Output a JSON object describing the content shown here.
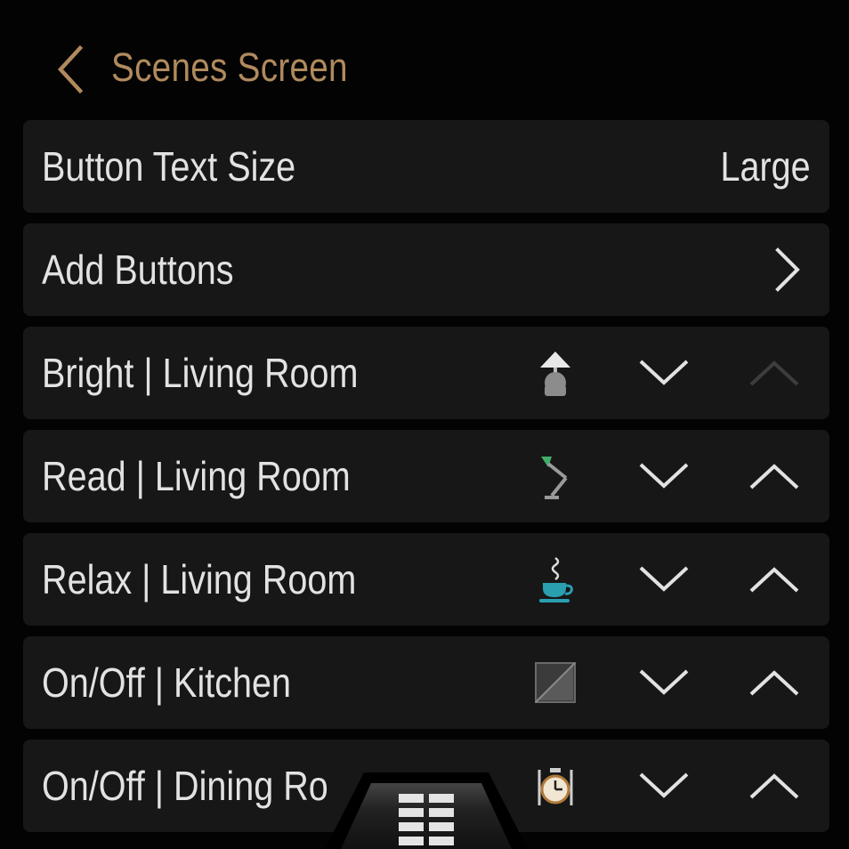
{
  "header": {
    "title": "Scenes Screen",
    "back_icon": "chevron-left-icon",
    "accent_color": "#b08a5e"
  },
  "settings": {
    "text_size": {
      "label": "Button Text Size",
      "value": "Large"
    },
    "add_buttons": {
      "label": "Add Buttons",
      "icon": "chevron-right-icon"
    }
  },
  "scenes": [
    {
      "label": "Bright | Living Room",
      "icon": "table-lamp-icon",
      "move_up_enabled": false
    },
    {
      "label": "Read | Living Room",
      "icon": "desk-lamp-icon",
      "move_up_enabled": true
    },
    {
      "label": "Relax | Living Room",
      "icon": "coffee-cup-icon",
      "move_up_enabled": true
    },
    {
      "label": "On/Off | Kitchen",
      "icon": "image-placeholder-icon",
      "move_up_enabled": true
    },
    {
      "label": "On/Off | Dining Ro",
      "icon": "dinner-clock-icon",
      "move_up_enabled": true
    }
  ],
  "footer": {
    "menu_icon": "grid-menu-icon"
  }
}
